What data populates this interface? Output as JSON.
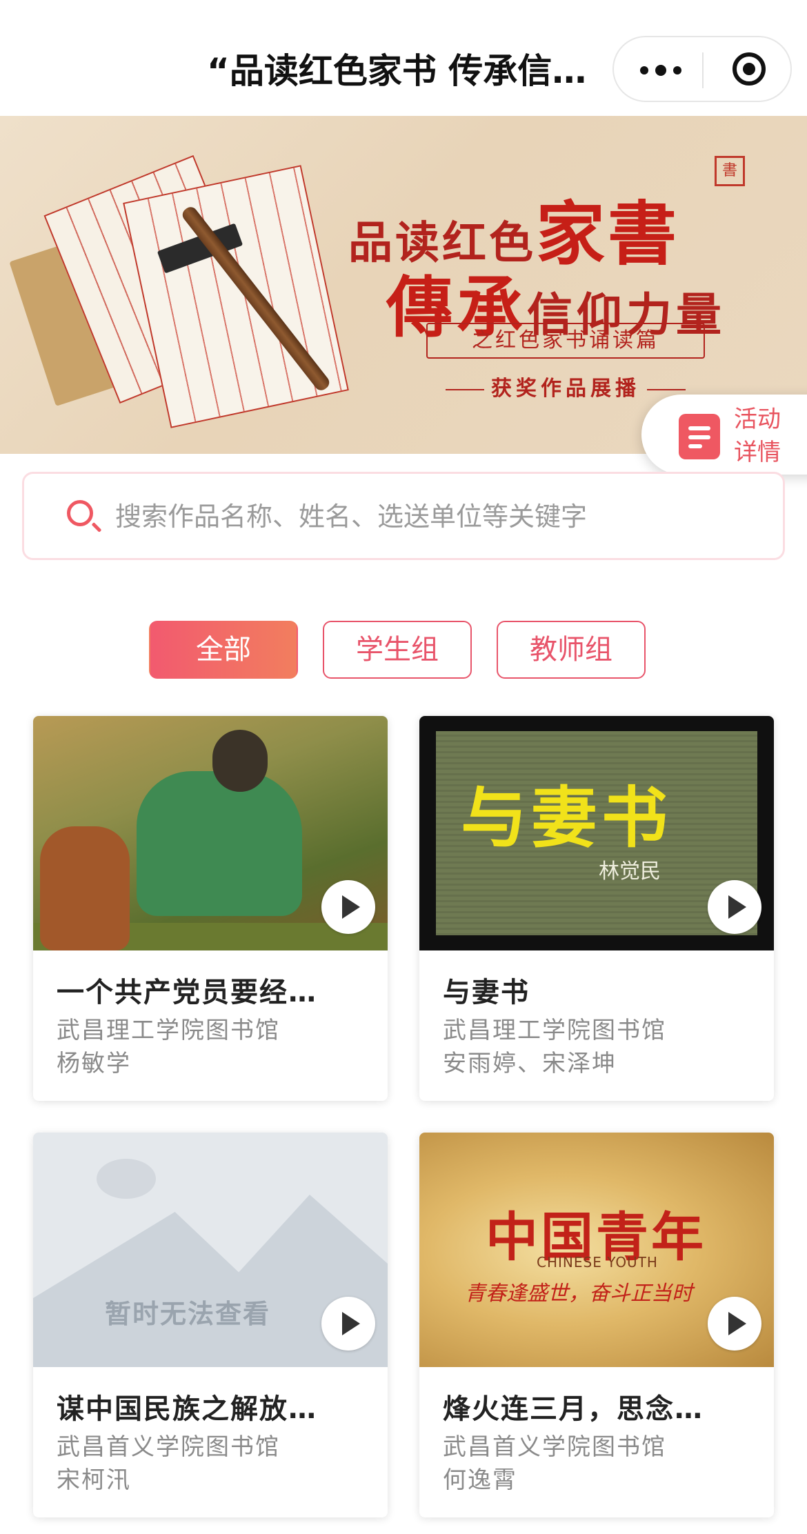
{
  "header": {
    "title": "“品读红色家书 传承信…",
    "more_icon": "more-dots-icon",
    "close_icon": "target-close-icon"
  },
  "banner": {
    "line1_a": "品读红色",
    "line1_b": "家書",
    "line2_a": "傳承",
    "line2_b": "信仰力量",
    "subtitle": "之红色家书诵读篇",
    "award": "获奖作品展播",
    "seal": "書"
  },
  "activity": {
    "label": "活动详情",
    "icon": "document-list-icon"
  },
  "search": {
    "placeholder": "搜索作品名称、姓名、选送单位等关键字"
  },
  "tabs": [
    {
      "label": "全部",
      "active": true
    },
    {
      "label": "学生组",
      "active": false
    },
    {
      "label": "教师组",
      "active": false
    }
  ],
  "cards": [
    {
      "title": "一个共产党员要经…",
      "org": "武昌理工学院图书馆",
      "name": "杨敏学"
    },
    {
      "title": "与妻书",
      "org": "武昌理工学院图书馆",
      "name": "安雨婷、宋泽坤",
      "thumb_text": "与妻书",
      "thumb_author": "林觉民"
    },
    {
      "title": "谋中国民族之解放…",
      "org": "武昌首义学院图书馆",
      "name": "宋柯汛",
      "thumb_text": "暂时无法查看"
    },
    {
      "title": "烽火连三月，思念…",
      "org": "武昌首义学院图书馆",
      "name": "何逸霄",
      "thumb_text": "中国青年",
      "thumb_en": "CHINESE YOUTH",
      "thumb_sub": "青春逢盛世，奋斗正当时"
    }
  ],
  "colors": {
    "accent": "#ef5862",
    "tab_gradient_start": "#f25a6f",
    "tab_gradient_end": "#f27e5e",
    "banner_red": "#b2231d"
  }
}
